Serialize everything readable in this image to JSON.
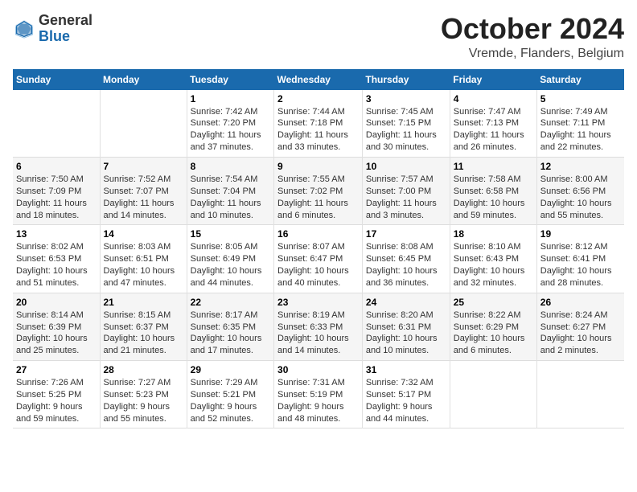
{
  "header": {
    "logo_general": "General",
    "logo_blue": "Blue",
    "month_year": "October 2024",
    "location": "Vremde, Flanders, Belgium"
  },
  "weekdays": [
    "Sunday",
    "Monday",
    "Tuesday",
    "Wednesday",
    "Thursday",
    "Friday",
    "Saturday"
  ],
  "weeks": [
    [
      {
        "day": "",
        "sunrise": "",
        "sunset": "",
        "daylight": ""
      },
      {
        "day": "",
        "sunrise": "",
        "sunset": "",
        "daylight": ""
      },
      {
        "day": "1",
        "sunrise": "Sunrise: 7:42 AM",
        "sunset": "Sunset: 7:20 PM",
        "daylight": "Daylight: 11 hours and 37 minutes."
      },
      {
        "day": "2",
        "sunrise": "Sunrise: 7:44 AM",
        "sunset": "Sunset: 7:18 PM",
        "daylight": "Daylight: 11 hours and 33 minutes."
      },
      {
        "day": "3",
        "sunrise": "Sunrise: 7:45 AM",
        "sunset": "Sunset: 7:15 PM",
        "daylight": "Daylight: 11 hours and 30 minutes."
      },
      {
        "day": "4",
        "sunrise": "Sunrise: 7:47 AM",
        "sunset": "Sunset: 7:13 PM",
        "daylight": "Daylight: 11 hours and 26 minutes."
      },
      {
        "day": "5",
        "sunrise": "Sunrise: 7:49 AM",
        "sunset": "Sunset: 7:11 PM",
        "daylight": "Daylight: 11 hours and 22 minutes."
      }
    ],
    [
      {
        "day": "6",
        "sunrise": "Sunrise: 7:50 AM",
        "sunset": "Sunset: 7:09 PM",
        "daylight": "Daylight: 11 hours and 18 minutes."
      },
      {
        "day": "7",
        "sunrise": "Sunrise: 7:52 AM",
        "sunset": "Sunset: 7:07 PM",
        "daylight": "Daylight: 11 hours and 14 minutes."
      },
      {
        "day": "8",
        "sunrise": "Sunrise: 7:54 AM",
        "sunset": "Sunset: 7:04 PM",
        "daylight": "Daylight: 11 hours and 10 minutes."
      },
      {
        "day": "9",
        "sunrise": "Sunrise: 7:55 AM",
        "sunset": "Sunset: 7:02 PM",
        "daylight": "Daylight: 11 hours and 6 minutes."
      },
      {
        "day": "10",
        "sunrise": "Sunrise: 7:57 AM",
        "sunset": "Sunset: 7:00 PM",
        "daylight": "Daylight: 11 hours and 3 minutes."
      },
      {
        "day": "11",
        "sunrise": "Sunrise: 7:58 AM",
        "sunset": "Sunset: 6:58 PM",
        "daylight": "Daylight: 10 hours and 59 minutes."
      },
      {
        "day": "12",
        "sunrise": "Sunrise: 8:00 AM",
        "sunset": "Sunset: 6:56 PM",
        "daylight": "Daylight: 10 hours and 55 minutes."
      }
    ],
    [
      {
        "day": "13",
        "sunrise": "Sunrise: 8:02 AM",
        "sunset": "Sunset: 6:53 PM",
        "daylight": "Daylight: 10 hours and 51 minutes."
      },
      {
        "day": "14",
        "sunrise": "Sunrise: 8:03 AM",
        "sunset": "Sunset: 6:51 PM",
        "daylight": "Daylight: 10 hours and 47 minutes."
      },
      {
        "day": "15",
        "sunrise": "Sunrise: 8:05 AM",
        "sunset": "Sunset: 6:49 PM",
        "daylight": "Daylight: 10 hours and 44 minutes."
      },
      {
        "day": "16",
        "sunrise": "Sunrise: 8:07 AM",
        "sunset": "Sunset: 6:47 PM",
        "daylight": "Daylight: 10 hours and 40 minutes."
      },
      {
        "day": "17",
        "sunrise": "Sunrise: 8:08 AM",
        "sunset": "Sunset: 6:45 PM",
        "daylight": "Daylight: 10 hours and 36 minutes."
      },
      {
        "day": "18",
        "sunrise": "Sunrise: 8:10 AM",
        "sunset": "Sunset: 6:43 PM",
        "daylight": "Daylight: 10 hours and 32 minutes."
      },
      {
        "day": "19",
        "sunrise": "Sunrise: 8:12 AM",
        "sunset": "Sunset: 6:41 PM",
        "daylight": "Daylight: 10 hours and 28 minutes."
      }
    ],
    [
      {
        "day": "20",
        "sunrise": "Sunrise: 8:14 AM",
        "sunset": "Sunset: 6:39 PM",
        "daylight": "Daylight: 10 hours and 25 minutes."
      },
      {
        "day": "21",
        "sunrise": "Sunrise: 8:15 AM",
        "sunset": "Sunset: 6:37 PM",
        "daylight": "Daylight: 10 hours and 21 minutes."
      },
      {
        "day": "22",
        "sunrise": "Sunrise: 8:17 AM",
        "sunset": "Sunset: 6:35 PM",
        "daylight": "Daylight: 10 hours and 17 minutes."
      },
      {
        "day": "23",
        "sunrise": "Sunrise: 8:19 AM",
        "sunset": "Sunset: 6:33 PM",
        "daylight": "Daylight: 10 hours and 14 minutes."
      },
      {
        "day": "24",
        "sunrise": "Sunrise: 8:20 AM",
        "sunset": "Sunset: 6:31 PM",
        "daylight": "Daylight: 10 hours and 10 minutes."
      },
      {
        "day": "25",
        "sunrise": "Sunrise: 8:22 AM",
        "sunset": "Sunset: 6:29 PM",
        "daylight": "Daylight: 10 hours and 6 minutes."
      },
      {
        "day": "26",
        "sunrise": "Sunrise: 8:24 AM",
        "sunset": "Sunset: 6:27 PM",
        "daylight": "Daylight: 10 hours and 2 minutes."
      }
    ],
    [
      {
        "day": "27",
        "sunrise": "Sunrise: 7:26 AM",
        "sunset": "Sunset: 5:25 PM",
        "daylight": "Daylight: 9 hours and 59 minutes."
      },
      {
        "day": "28",
        "sunrise": "Sunrise: 7:27 AM",
        "sunset": "Sunset: 5:23 PM",
        "daylight": "Daylight: 9 hours and 55 minutes."
      },
      {
        "day": "29",
        "sunrise": "Sunrise: 7:29 AM",
        "sunset": "Sunset: 5:21 PM",
        "daylight": "Daylight: 9 hours and 52 minutes."
      },
      {
        "day": "30",
        "sunrise": "Sunrise: 7:31 AM",
        "sunset": "Sunset: 5:19 PM",
        "daylight": "Daylight: 9 hours and 48 minutes."
      },
      {
        "day": "31",
        "sunrise": "Sunrise: 7:32 AM",
        "sunset": "Sunset: 5:17 PM",
        "daylight": "Daylight: 9 hours and 44 minutes."
      },
      {
        "day": "",
        "sunrise": "",
        "sunset": "",
        "daylight": ""
      },
      {
        "day": "",
        "sunrise": "",
        "sunset": "",
        "daylight": ""
      }
    ]
  ]
}
